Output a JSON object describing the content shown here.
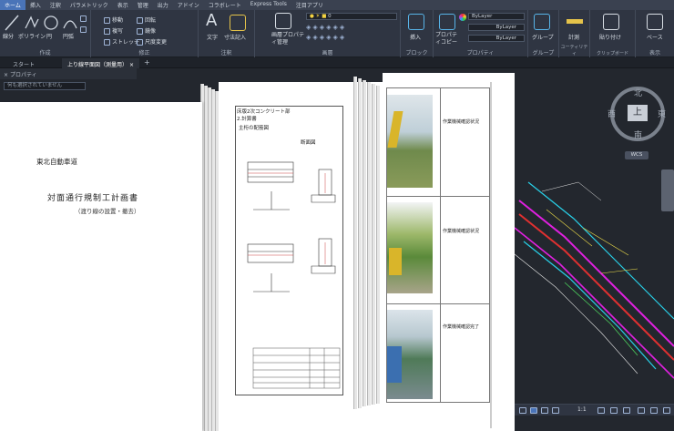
{
  "menu_tabs": [
    "ホーム",
    "挿入",
    "注釈",
    "パラメトリック",
    "表示",
    "管理",
    "出力",
    "アドイン",
    "コラボレート",
    "Express Tools",
    "注目アプリ"
  ],
  "ribbon": {
    "draw": {
      "title": "作成",
      "buttons": [
        "線分",
        "ポリライン",
        "円",
        "円弧"
      ]
    },
    "modify": {
      "title": "修正",
      "buttons": [
        "移動",
        "回転",
        "複写",
        "鏡像",
        "ストレッチ",
        "尺度変更"
      ]
    },
    "annotation": {
      "title": "注釈",
      "buttons": [
        "文字",
        "寸法記入"
      ]
    },
    "layers": {
      "title": "画層",
      "buttons": [
        "画層プロパティ管理"
      ],
      "layer_value": "0"
    },
    "block": {
      "title": "ブロック",
      "buttons": [
        "挿入"
      ]
    },
    "properties": {
      "title": "プロパティ",
      "buttons": [
        "プロパティコピー"
      ],
      "color": "ByLayer",
      "linetype": "ByLayer",
      "lineweight": "ByLayer"
    },
    "groups": {
      "title": "グループ",
      "buttons": [
        "グループ"
      ]
    },
    "utilities": {
      "title": "ユーティリティ",
      "buttons": [
        "計測"
      ]
    },
    "clipboard": {
      "title": "クリップボード",
      "buttons": [
        "貼り付け"
      ]
    },
    "view": {
      "title": "表示",
      "buttons": [
        "ベース"
      ]
    }
  },
  "doc_tabs": [
    "スタート",
    "上り線平面図（測量用）"
  ],
  "properties_panel": {
    "title": "プロパティ",
    "selection": "何も選択されていません"
  },
  "viewcube": {
    "north": "北",
    "south": "南",
    "east": "東",
    "west": "西",
    "face": "上",
    "wcs": "WCS"
  },
  "statusbar": {
    "scale": "1:1"
  },
  "cover": {
    "org": "東北自動車道",
    "title": "対面通行規制工計画書",
    "subtitle": "（渡り線の設置・撤去）"
  },
  "drawing_sheet": {
    "headings": [
      "床版2次コンクリート部",
      "2.計算書",
      "主桁の配筋図"
    ],
    "section_labels": [
      "断面図"
    ]
  },
  "photo_sheet": {
    "captions": [
      "作業機械確認状況",
      "作業機械確認状況",
      "作業機械確認完了"
    ]
  },
  "colors": {
    "ribbon_bg": "#2f3542",
    "canvas_bg": "#23272e",
    "active_tab": "#4a74b8",
    "cad_magenta": "#e020e0",
    "cad_cyan": "#28d0e8",
    "cad_red": "#e03030"
  }
}
